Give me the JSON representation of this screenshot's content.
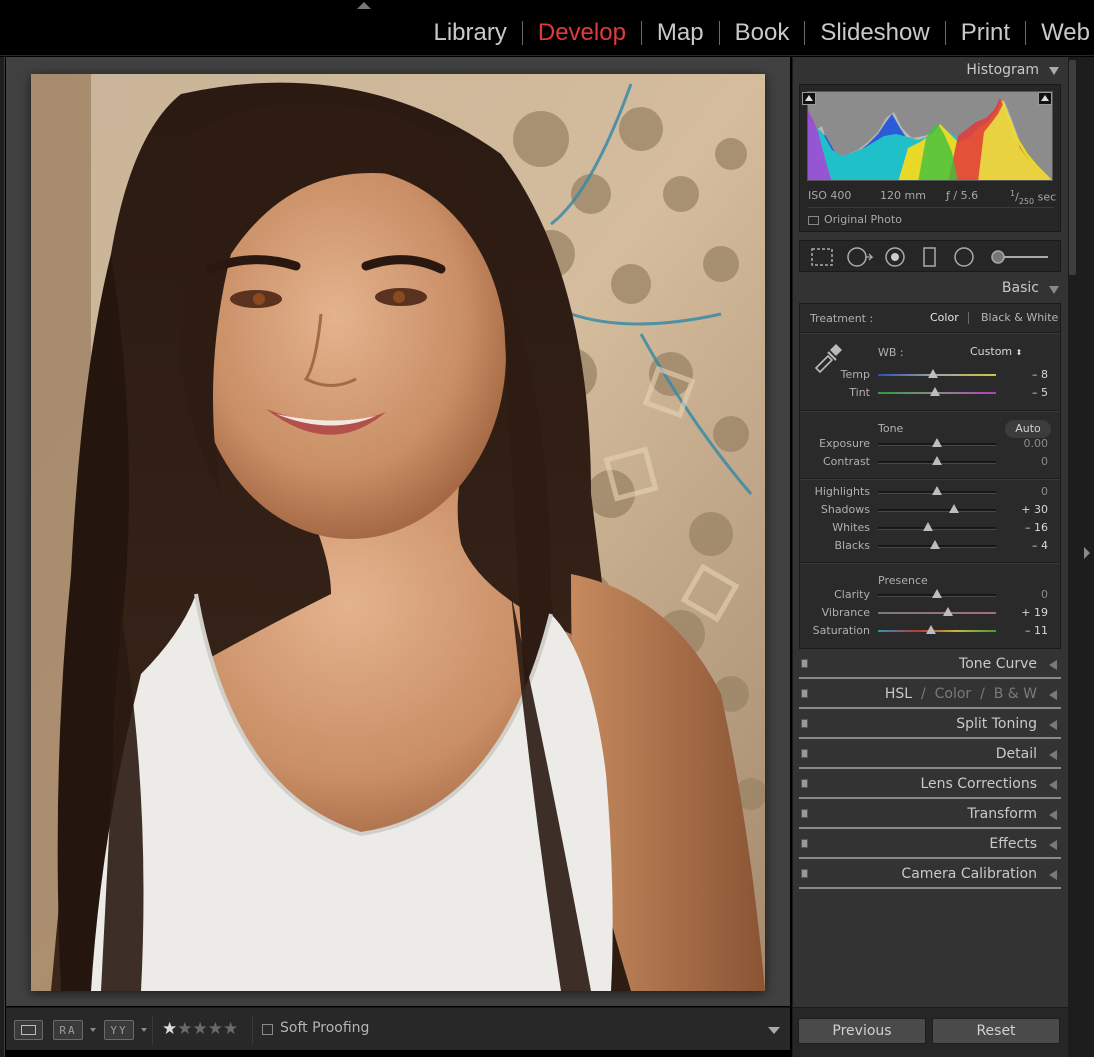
{
  "modules": [
    "Library",
    "Develop",
    "Map",
    "Book",
    "Slideshow",
    "Print",
    "Web"
  ],
  "active_module": "Develop",
  "histogram": {
    "title": "Histogram",
    "iso": "ISO 400",
    "focal": "120 mm",
    "aperture": "ƒ / 5.6",
    "shutter_num": "1",
    "shutter_den": "250",
    "shutter_unit": "sec",
    "original_photo": "Original Photo"
  },
  "basic": {
    "title": "Basic",
    "treatment_label": "Treatment :",
    "treatment_color": "Color",
    "treatment_bw": "Black & White",
    "wb_label": "WB :",
    "wb_value": "Custom",
    "tone_label": "Tone",
    "auto_label": "Auto",
    "presence_label": "Presence",
    "sliders": [
      {
        "label": "Temp",
        "value": "– 8",
        "pos": 0.47
      },
      {
        "label": "Tint",
        "value": "– 5",
        "pos": 0.48
      },
      {
        "label": "Exposure",
        "value": "0.00",
        "pos": 0.5
      },
      {
        "label": "Contrast",
        "value": "0",
        "pos": 0.5
      },
      {
        "label": "Highlights",
        "value": "0",
        "pos": 0.5
      },
      {
        "label": "Shadows",
        "value": "+ 30",
        "pos": 0.64
      },
      {
        "label": "Whites",
        "value": "– 16",
        "pos": 0.42
      },
      {
        "label": "Blacks",
        "value": "– 4",
        "pos": 0.48
      },
      {
        "label": "Clarity",
        "value": "0",
        "pos": 0.5
      },
      {
        "label": "Vibrance",
        "value": "+ 19",
        "pos": 0.59
      },
      {
        "label": "Saturation",
        "value": "– 11",
        "pos": 0.45
      }
    ]
  },
  "panels": {
    "tone_curve": "Tone Curve",
    "hsl_a": "HSL",
    "hsl_sep": "/",
    "hsl_b": "Color",
    "hsl_c": "B & W",
    "split_toning": "Split Toning",
    "detail": "Detail",
    "lens": "Lens Corrections",
    "transform": "Transform",
    "effects": "Effects",
    "calibration": "Camera Calibration"
  },
  "buttons": {
    "previous": "Previous",
    "reset": "Reset"
  },
  "toolbar": {
    "ra": "RA",
    "yy": "YY",
    "rating": 1,
    "stars_total": 5,
    "soft_proofing": "Soft Proofing"
  }
}
